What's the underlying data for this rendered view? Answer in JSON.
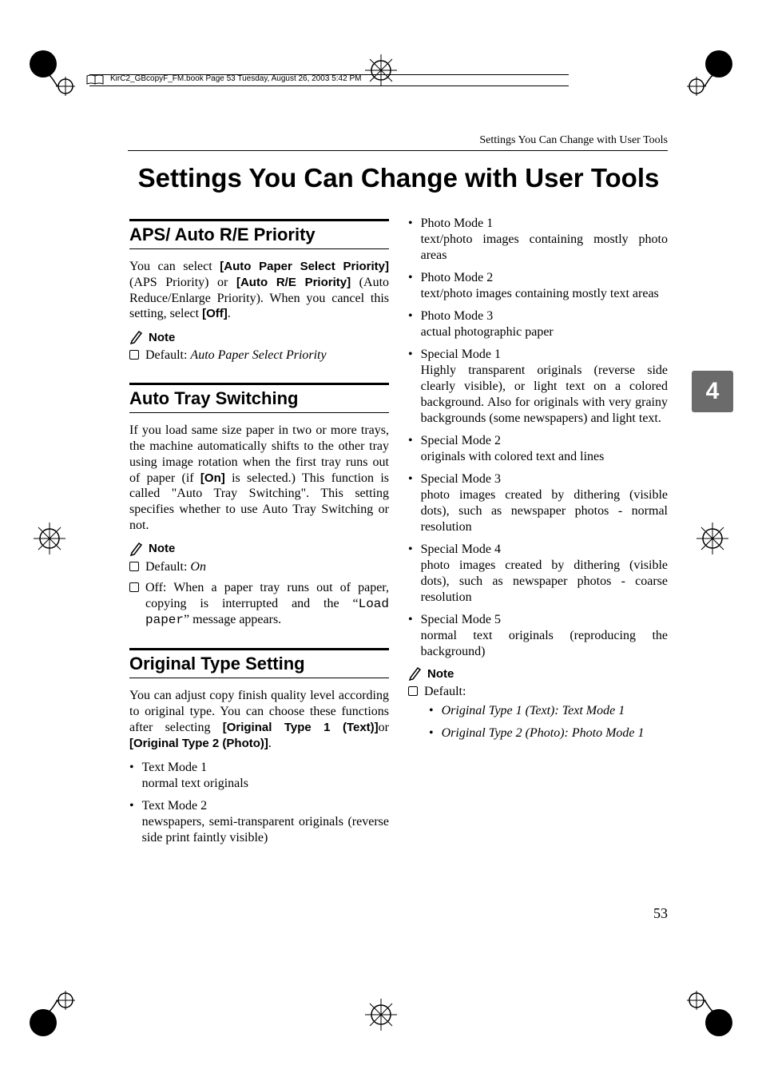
{
  "print_header": "KirC2_GBcopyF_FM.book  Page 53  Tuesday, August 26, 2003  5:42 PM",
  "running_head": "Settings You Can Change with User Tools",
  "main_title": "Settings You Can Change with User Tools",
  "tab_number": "4",
  "page_number": "53",
  "left": {
    "s1": {
      "title": "APS/ Auto R/E Priority",
      "p": {
        "t1": "You can select ",
        "b1": "[Auto Paper Select Priority]",
        "t2": " (APS Priority) or ",
        "b2": "[Auto R/E Priority]",
        "t3": " (Auto Reduce/Enlarge Priority). When you cancel this setting, select ",
        "b3": "[Off]",
        "t4": "."
      },
      "note_label": "Note",
      "note_item": {
        "lead": "Default: ",
        "val": "Auto Paper Select Priority"
      }
    },
    "s2": {
      "title": "Auto Tray Switching",
      "p": {
        "t1": "If you load same size paper in two or more trays, the machine automatically shifts to the other tray using image rotation when the first tray runs out of paper (if ",
        "b1": "[On]",
        "t2": " is selected.) This function is called \"Auto Tray Switching\". This setting specifies whether to use Auto Tray Switching or not."
      },
      "note_label": "Note",
      "note_item1": {
        "lead": "Default: ",
        "val": "On"
      },
      "note_item2": {
        "t1": "Off: When a paper tray runs out of paper, copying is interrupted and the “",
        "mono": "Load paper",
        "t2": "” message appears."
      }
    },
    "s3": {
      "title": "Original Type Setting",
      "p": {
        "t1": "You can adjust copy finish quality level according to original type. You can choose these functions after selecting ",
        "b1": "[Original Type 1 (Text)]",
        "t2": "or ",
        "b2": "[Original Type 2 (Photo)]",
        "t3": "."
      },
      "items": [
        {
          "head": "Text Mode 1",
          "body": "normal text originals"
        },
        {
          "head": "Text Mode 2",
          "body": "newspapers, semi-transparent originals (reverse side print faintly visible)"
        }
      ]
    }
  },
  "right": {
    "items": [
      {
        "head": "Photo Mode 1",
        "body": "text/photo images containing mostly photo areas"
      },
      {
        "head": "Photo Mode 2",
        "body": "text/photo images containing mostly text areas"
      },
      {
        "head": "Photo Mode 3",
        "body": "actual photographic paper"
      },
      {
        "head": "Special Mode 1",
        "body": "Highly transparent originals (reverse side clearly visible), or light text on a colored background. Also for originals with very grainy backgrounds (some newspapers) and light text."
      },
      {
        "head": "Special Mode 2",
        "body": "originals with colored text and lines"
      },
      {
        "head": "Special Mode 3",
        "body": "photo images created by dithering (visible dots), such as newspaper photos - normal resolution"
      },
      {
        "head": "Special Mode 4",
        "body": "photo images created by dithering (visible dots), such as newspaper photos - coarse resolution"
      },
      {
        "head": "Special Mode 5",
        "body": "normal text originals (reproducing the background)"
      }
    ],
    "note_label": "Note",
    "note_default_lead": "Default:",
    "note_defaults": [
      "Original Type 1 (Text): Text Mode 1",
      "Original Type 2 (Photo): Photo Mode 1"
    ]
  }
}
